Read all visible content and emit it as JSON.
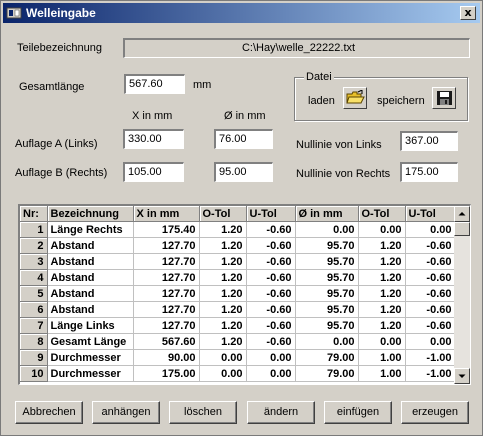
{
  "window": {
    "title": "Welleingabe",
    "close_label": "x"
  },
  "part": {
    "label": "Teilebezeichnung",
    "value": "C:\\Hay\\welle_22222.txt"
  },
  "length": {
    "label": "Gesamtlänge",
    "value": "567.60",
    "unit": "mm"
  },
  "file_group": {
    "title": "Datei",
    "load_label": "laden",
    "save_label": "speichern"
  },
  "col_headers": {
    "x": "X in mm",
    "d": "Ø in mm"
  },
  "support_a": {
    "label": "Auflage A (Links)",
    "x": "330.00",
    "d": "76.00"
  },
  "support_b": {
    "label": "Auflage B (Rechts)",
    "x": "105.00",
    "d": "95.00"
  },
  "zero_left": {
    "label": "Nullinie von Links",
    "value": "367.00"
  },
  "zero_right": {
    "label": "Nullinie von Rechts",
    "value": "175.00"
  },
  "table": {
    "columns": [
      "Nr:",
      "Bezeichnung",
      "X in mm",
      "O-Tol",
      "U-Tol",
      "Ø in mm",
      "O-Tol",
      "U-Tol"
    ],
    "rows": [
      [
        "1",
        "Länge Rechts",
        "175.40",
        "1.20",
        "-0.60",
        "0.00",
        "0.00",
        "0.00"
      ],
      [
        "2",
        "Abstand",
        "127.70",
        "1.20",
        "-0.60",
        "95.70",
        "1.20",
        "-0.60"
      ],
      [
        "3",
        "Abstand",
        "127.70",
        "1.20",
        "-0.60",
        "95.70",
        "1.20",
        "-0.60"
      ],
      [
        "4",
        "Abstand",
        "127.70",
        "1.20",
        "-0.60",
        "95.70",
        "1.20",
        "-0.60"
      ],
      [
        "5",
        "Abstand",
        "127.70",
        "1.20",
        "-0.60",
        "95.70",
        "1.20",
        "-0.60"
      ],
      [
        "6",
        "Abstand",
        "127.70",
        "1.20",
        "-0.60",
        "95.70",
        "1.20",
        "-0.60"
      ],
      [
        "7",
        "Länge Links",
        "127.70",
        "1.20",
        "-0.60",
        "95.70",
        "1.20",
        "-0.60"
      ],
      [
        "8",
        "Gesamt Länge",
        "567.60",
        "1.20",
        "-0.60",
        "0.00",
        "0.00",
        "0.00"
      ],
      [
        "9",
        "Durchmesser",
        "90.00",
        "0.00",
        "0.00",
        "79.00",
        "1.00",
        "-1.00"
      ],
      [
        "10",
        "Durchmesser",
        "175.00",
        "0.00",
        "0.00",
        "79.00",
        "1.00",
        "-1.00"
      ]
    ]
  },
  "buttons": {
    "cancel": "Abbrechen",
    "append": "anhängen",
    "delete": "löschen",
    "change": "ändern",
    "insert": "einfügen",
    "generate": "erzeugen"
  },
  "icons": {
    "window": "app-icon",
    "load": "folder-open-icon",
    "save": "floppy-disk-icon"
  }
}
